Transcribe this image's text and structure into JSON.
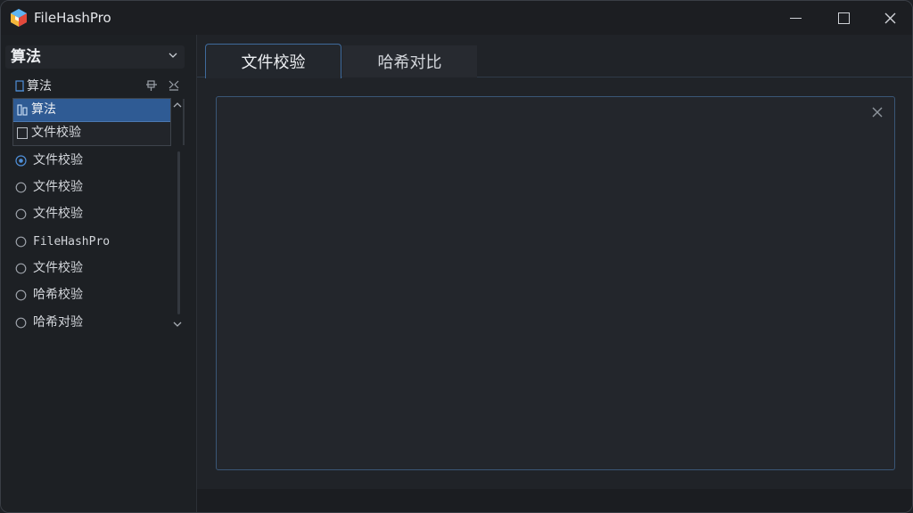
{
  "window": {
    "title": "FileHashPro"
  },
  "sidebar": {
    "header_title": "算法",
    "sub_label": "算法",
    "dropdown": [
      {
        "label": "算法",
        "selected": true
      },
      {
        "label": "文件校验",
        "selected": false
      }
    ],
    "items": [
      {
        "label": "文件校验",
        "icon": "radio-checked-icon"
      },
      {
        "label": "文件校验",
        "icon": "circle-icon"
      },
      {
        "label": "文件校验",
        "icon": "circle-icon"
      },
      {
        "label": "FileHashPro",
        "icon": "circle-icon"
      },
      {
        "label": "文件校验",
        "icon": "circle-icon"
      },
      {
        "label": "哈希校验",
        "icon": "circle-icon"
      },
      {
        "label": "哈希对验",
        "icon": "circle-icon"
      }
    ]
  },
  "main": {
    "tabs": [
      {
        "label": "文件校验",
        "active": true
      },
      {
        "label": "哈希对比",
        "active": false
      }
    ]
  },
  "colors": {
    "accent": "#2f5b94",
    "tab_border": "#3f6a9c",
    "background": "#1f2227"
  }
}
